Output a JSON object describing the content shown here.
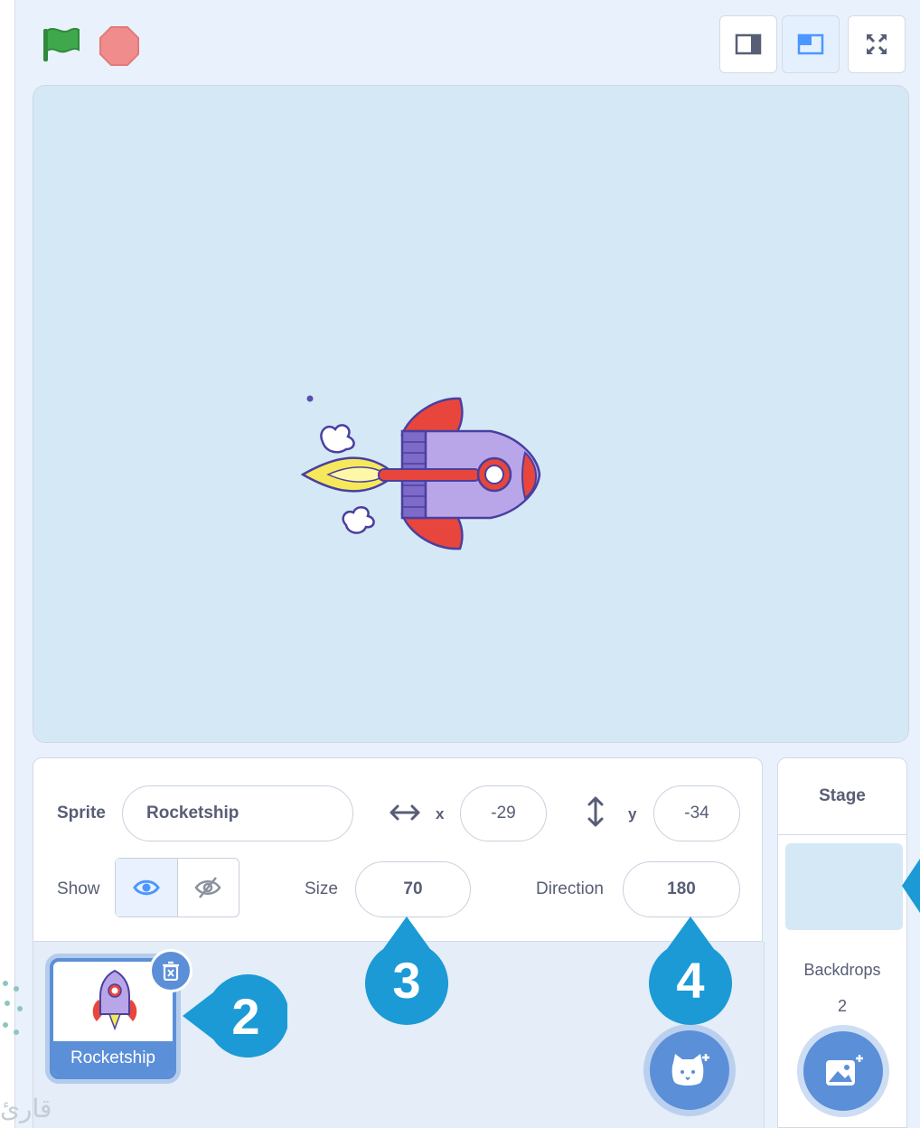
{
  "colors": {
    "accent": "#5b8fd8",
    "callout": "#1b9ad6",
    "stage_bg": "#d5e8f5",
    "flag": "#3fa84c",
    "stop": "#f08c8c"
  },
  "toolbar": {
    "flag_icon": "green-flag-icon",
    "stop_icon": "stop-icon",
    "view_buttons": [
      "small-stage-icon",
      "normal-stage-icon",
      "fullscreen-icon"
    ]
  },
  "sprite_info": {
    "sprite_label": "Sprite",
    "sprite_name": "Rocketship",
    "x_label": "x",
    "x_value": "-29",
    "y_label": "y",
    "y_value": "-34",
    "show_label": "Show",
    "size_label": "Size",
    "size_value": "70",
    "direction_label": "Direction",
    "direction_value": "180"
  },
  "sprites": [
    {
      "name": "Rocketship",
      "selected": true
    }
  ],
  "stage_panel": {
    "title": "Stage",
    "backdrops_label": "Backdrops",
    "backdrops_count": "2"
  },
  "callouts": [
    "2",
    "3",
    "4"
  ],
  "watermark": "قارئ"
}
